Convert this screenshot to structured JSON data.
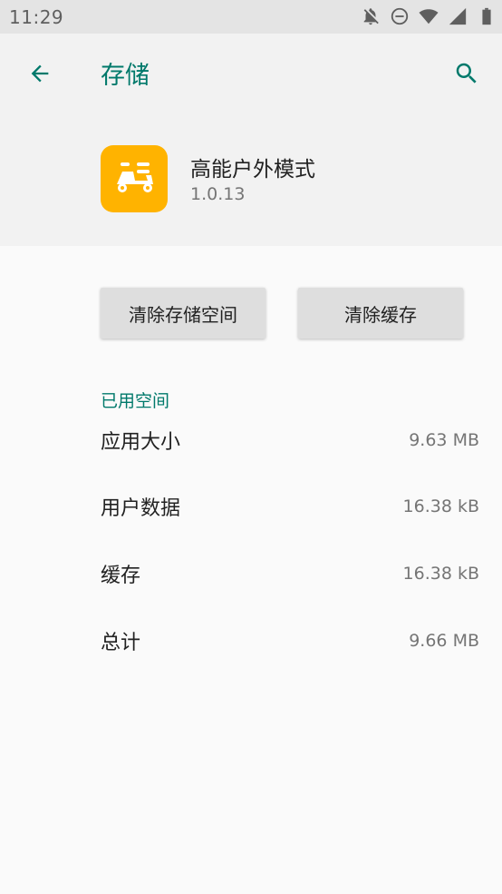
{
  "status_bar": {
    "time": "11:29",
    "icons": [
      "notifications-off-icon",
      "do-not-disturb-icon",
      "wifi-icon",
      "signal-icon",
      "battery-icon"
    ]
  },
  "toolbar": {
    "back_icon": "arrow-back-icon",
    "title": "存储",
    "search_icon": "search-icon"
  },
  "app": {
    "name": "高能户外模式",
    "version": "1.0.13",
    "icon": "scooter-icon",
    "icon_color": "#ffb300"
  },
  "buttons": {
    "clear_storage": "清除存储空间",
    "clear_cache": "清除缓存"
  },
  "storage": {
    "section_title": "已用空间",
    "rows": [
      {
        "label": "应用大小",
        "value": "9.63 MB"
      },
      {
        "label": "用户数据",
        "value": "16.38 kB"
      },
      {
        "label": "缓存",
        "value": "16.38 kB"
      },
      {
        "label": "总计",
        "value": "9.66 MB"
      }
    ]
  },
  "colors": {
    "accent": "#00796b",
    "status_bar_bg": "#e4e4e4",
    "header_bg": "#f2f2f2",
    "page_bg": "#fafafa"
  }
}
